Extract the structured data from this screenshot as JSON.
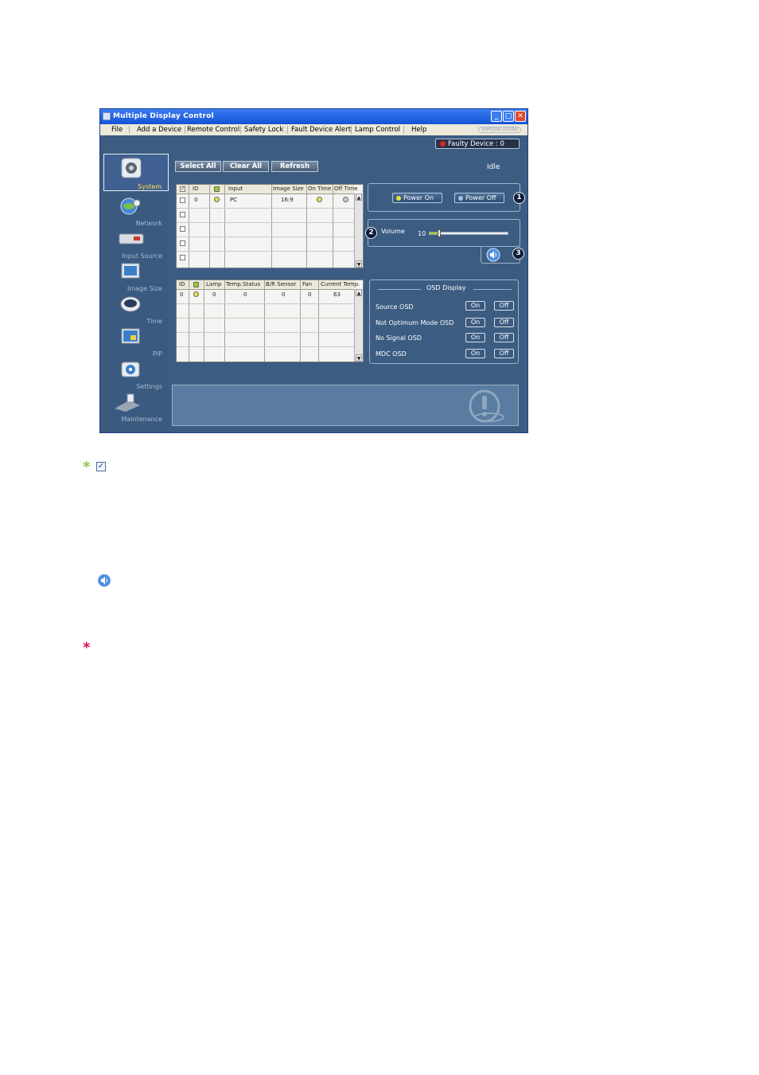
{
  "window": {
    "title": "Multiple Display Control"
  },
  "menu": [
    "File",
    "Add a Device",
    "Remote Control",
    "Safety Lock",
    "Fault Device Alert",
    "Lamp Control",
    "Help"
  ],
  "brand": "SAMSUNG DIGITall",
  "faulty": "Faulty Device : 0",
  "status": "Idle",
  "sidebar": [
    {
      "label": "System",
      "icon": "system-icon",
      "selected": true
    },
    {
      "label": "Network",
      "icon": "network-icon"
    },
    {
      "label": "Input Source",
      "icon": "input-source-icon"
    },
    {
      "label": "Image Size",
      "icon": "image-size-icon"
    },
    {
      "label": "Time",
      "icon": "time-icon"
    },
    {
      "label": "PIP",
      "icon": "pip-icon"
    },
    {
      "label": "Settings",
      "icon": "settings-icon"
    },
    {
      "label": "Maintenance",
      "icon": "maintenance-icon"
    }
  ],
  "toolbar": {
    "select_all": "Select All",
    "clear_all": "Clear All",
    "refresh": "Refresh"
  },
  "grid1": {
    "headers": [
      "ID",
      "Input",
      "Image Size",
      "On Time",
      "Off Time"
    ],
    "row": {
      "id": "0",
      "input": "PC",
      "image_size": "16:9"
    }
  },
  "grid2": {
    "headers": [
      "ID",
      "Lamp",
      "Temp.Status",
      "B/R Sensor",
      "Fan",
      "Current Temp."
    ],
    "row": {
      "id": "0",
      "lamp": "0",
      "temp_status": "0",
      "br_sensor": "0",
      "fan": "0",
      "current_temp": "63"
    }
  },
  "power": {
    "on": "Power On",
    "off": "Power Off"
  },
  "volume": {
    "label": "Volume",
    "value": "10",
    "level": 0.1
  },
  "badges": [
    "1",
    "2",
    "3"
  ],
  "osd": {
    "title": "OSD Display",
    "rows": [
      "Source OSD",
      "Not Optimum Mode OSD",
      "No Signal OSD",
      "MDC OSD"
    ],
    "on": "On",
    "off": "Off"
  },
  "colors": {
    "accent_green": "#8cc63f",
    "star_red": "#e0104a",
    "window_bg": "#3c5c82"
  }
}
